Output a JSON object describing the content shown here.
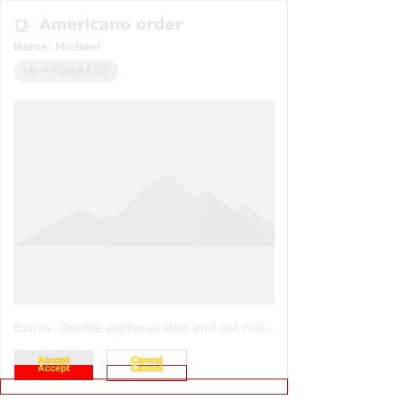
{
  "card": {
    "icon": "coffee-cup-icon",
    "title": "Americano order",
    "name_line": "Name: Michael",
    "status_badge": "IN PROGRESS",
    "image_icon": "image-placeholder-icon",
    "extras": "Extras: Double espresso shot and oat milk."
  },
  "actions": {
    "accept_label": "Accept",
    "cancel_label": "Cancel"
  },
  "colors": {
    "muted_text": "#e6e6e6",
    "placeholder_bg": "#f3f3f3",
    "accept_red": "#ff0000",
    "accent_yellow": "#ffff00",
    "outline_red": "#cc0000"
  }
}
